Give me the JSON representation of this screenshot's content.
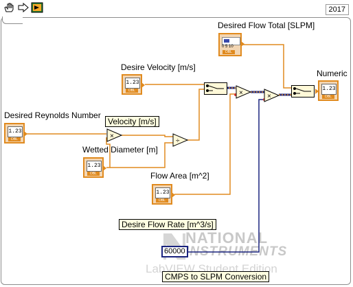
{
  "toolbar": {
    "icons": [
      "hand-tool-icon",
      "run-arrow-icon",
      "highlight-execution-icon"
    ],
    "version": "2017"
  },
  "labels": {
    "desired_flow_total": "Desired Flow Total [SLPM]",
    "desire_velocity": "Desire Velocity [m/s]",
    "numeric": "Numeric",
    "desired_reynolds": "Desired Reynolds Number",
    "velocity": "Velocity [m/s]",
    "wetted_diameter": "Wetted Diameter [m]",
    "flow_area": "Flow Area [m^2]",
    "desire_flow_rate": "Desire Flow Rate [m^3/s]",
    "cmps_to_slpm": "CMPS to SLPM Conversion"
  },
  "terminals": {
    "value_text": "1.23",
    "dbl_text": "DBL",
    "slider_ticks": "0  5  10"
  },
  "constant": {
    "value": "60000"
  },
  "nodes": {
    "multiply": "×",
    "divide": "÷"
  },
  "watermark": {
    "line1": "NATIONAL",
    "line2": "INSTRUMENTS",
    "edition": "LabVIEW Student Edition"
  },
  "colors": {
    "wire_orange": "#e08a1e",
    "wire_blue": "#1a237e",
    "terminal_fill": "#f3d6b3"
  }
}
